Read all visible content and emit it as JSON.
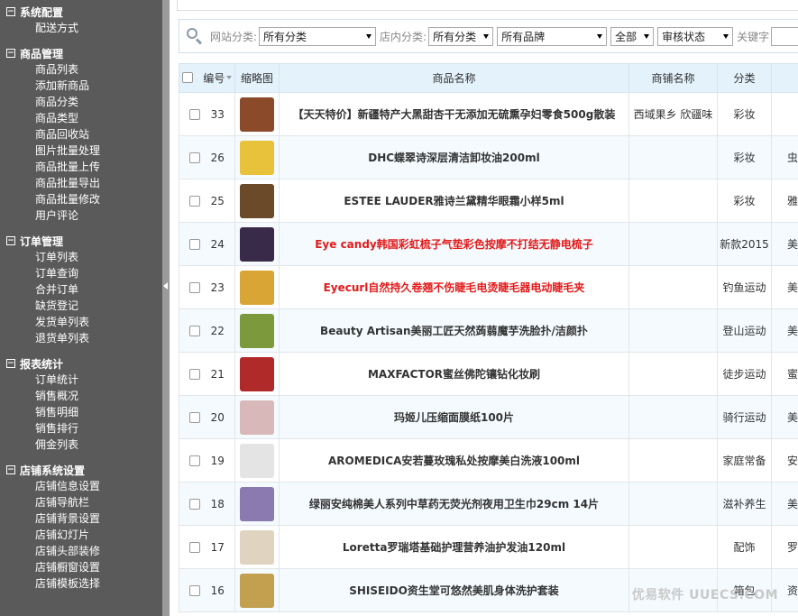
{
  "sidebar": {
    "groups": [
      {
        "title": "系统配置",
        "items": [
          "配送方式"
        ]
      },
      {
        "title": "商品管理",
        "items": [
          "商品列表",
          "添加新商品",
          "商品分类",
          "商品类型",
          "商品回收站",
          "图片批量处理",
          "商品批量上传",
          "商品批量导出",
          "商品批量修改",
          "用户评论"
        ]
      },
      {
        "title": "订单管理",
        "items": [
          "订单列表",
          "订单查询",
          "合并订单",
          "缺货登记",
          "发货单列表",
          "退货单列表"
        ]
      },
      {
        "title": "报表统计",
        "items": [
          "订单统计",
          "销售概况",
          "销售明细",
          "销售排行",
          "佣金列表"
        ]
      },
      {
        "title": "店铺系统设置",
        "items": [
          "店铺信息设置",
          "店铺导航栏",
          "店铺背景设置",
          "店铺幻灯片",
          "店铺头部装修",
          "店铺橱窗设置",
          "店铺模板选择"
        ]
      }
    ]
  },
  "filter": {
    "site_category_label": "网站分类:",
    "site_category_value": "所有分类",
    "shop_category_label": "店内分类:",
    "shop_category_value": "所有分类",
    "brand_value": "所有品牌",
    "type_value": "全部",
    "review_value": "审核状态",
    "keyword_label": "关键字"
  },
  "table": {
    "headers": {
      "id": "编号",
      "thumb": "缩略图",
      "name": "商品名称",
      "shop": "商铺名称",
      "category": "分类"
    },
    "rows": [
      {
        "id": "33",
        "name": "【天天特价】新疆特产大黑甜杏干无添加无硫熏孕妇零食500g散装",
        "shop": "西域果乡 欣疆味",
        "category": "彩妆",
        "extra": "",
        "red": false,
        "thumb_color": "#8b4a2a"
      },
      {
        "id": "26",
        "name": "DHC蝶翠诗深层清洁卸妆油200ml",
        "shop": "",
        "category": "彩妆",
        "extra": "虫",
        "red": false,
        "thumb_color": "#e8c23a"
      },
      {
        "id": "25",
        "name": "ESTEE LAUDER雅诗兰黛精华眼霜小样5ml",
        "shop": "",
        "category": "彩妆",
        "extra": "雅",
        "red": false,
        "thumb_color": "#6b4a2a"
      },
      {
        "id": "24",
        "name": "Eye candy韩国彩虹梳子气垫彩色按摩不打结无静电梳子",
        "shop": "",
        "category": "新款2015",
        "extra": "美",
        "red": true,
        "thumb_color": "#3a2a4a"
      },
      {
        "id": "23",
        "name": "Eyecurl自然持久卷翘不伤睫毛电烫睫毛器电动睫毛夹",
        "shop": "",
        "category": "钓鱼运动",
        "extra": "美",
        "red": true,
        "thumb_color": "#d9a534"
      },
      {
        "id": "22",
        "name": "Beauty Artisan美丽工匠天然蒟蒻魔芋洗脸扑/洁颜扑",
        "shop": "",
        "category": "登山运动",
        "extra": "美",
        "red": false,
        "thumb_color": "#7c9a3c"
      },
      {
        "id": "21",
        "name": "MAXFACTOR蜜丝佛陀镶钻化妆刷",
        "shop": "",
        "category": "徒步运动",
        "extra": "蜜",
        "red": false,
        "thumb_color": "#b02a2a"
      },
      {
        "id": "20",
        "name": "玛姬儿压缩面膜纸100片",
        "shop": "",
        "category": "骑行运动",
        "extra": "美",
        "red": false,
        "thumb_color": "#d8b8b8"
      },
      {
        "id": "19",
        "name": "AROMEDICA安若蔓玫瑰私处按摩美白洗液100ml",
        "shop": "",
        "category": "家庭常备",
        "extra": "安",
        "red": false,
        "thumb_color": "#e4e4e4"
      },
      {
        "id": "18",
        "name": "绿丽安纯棉美人系列中草药无荧光剂夜用卫生巾29cm 14片",
        "shop": "",
        "category": "滋补养生",
        "extra": "美",
        "red": false,
        "thumb_color": "#8a7ab0"
      },
      {
        "id": "17",
        "name": "Loretta罗瑞塔基础护理营养油护发油120ml",
        "shop": "",
        "category": "配饰",
        "extra": "罗",
        "red": false,
        "thumb_color": "#e0d4c0"
      },
      {
        "id": "16",
        "name": "SHISEIDO资生堂可悠然美肌身体洗护套装",
        "shop": "",
        "category": "箱包",
        "extra": "资",
        "red": false,
        "thumb_color": "#c2a050"
      }
    ]
  },
  "watermark": "优易软件 UUECS.COM"
}
